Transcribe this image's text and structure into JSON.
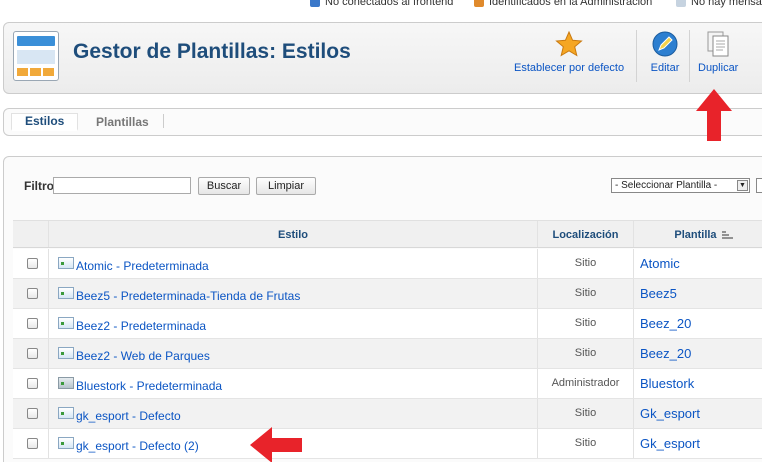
{
  "status_bar": {
    "frontend_label": "No conectados al frontend",
    "admin_label": "Identificados en la Administración",
    "messages_label": "No hay mensa"
  },
  "header": {
    "title": "Gestor de Plantillas: Estilos"
  },
  "toolbar": {
    "default_label": "Establecer por defecto",
    "edit_label": "Editar",
    "duplicate_label": "Duplicar"
  },
  "tabs": [
    {
      "label": "Estilos",
      "active": true
    },
    {
      "label": "Plantillas",
      "active": false
    }
  ],
  "filter": {
    "label": "Filtro:",
    "value": "",
    "search_button": "Buscar",
    "clear_button": "Limpiar",
    "template_select": "- Seleccionar Plantilla -"
  },
  "table": {
    "columns": {
      "style": "Estilo",
      "location": "Localización",
      "template": "Plantilla"
    },
    "rows": [
      {
        "name": "Atomic - Predeterminada",
        "location": "Sitio",
        "template": "Atomic"
      },
      {
        "name": "Beez5 - Predeterminada-Tienda de Frutas",
        "location": "Sitio",
        "template": "Beez5"
      },
      {
        "name": "Beez2 - Predeterminada",
        "location": "Sitio",
        "template": "Beez_20"
      },
      {
        "name": "Beez2 - Web de Parques",
        "location": "Sitio",
        "template": "Beez_20"
      },
      {
        "name": "Bluestork - Predeterminada",
        "location": "Administrador",
        "template": "Bluestork"
      },
      {
        "name": "gk_esport - Defecto",
        "location": "Sitio",
        "template": "Gk_esport"
      },
      {
        "name": "gk_esport - Defecto (2)",
        "location": "Sitio",
        "template": "Gk_esport"
      }
    ]
  },
  "colors": {
    "title": "#1e4d7b",
    "link": "#0b55c4",
    "annotation_arrow": "#e8232a"
  },
  "icons": {
    "default": "star-icon",
    "edit": "pencil-icon",
    "duplicate": "copy-documents-icon",
    "header": "template-manager-icon"
  }
}
